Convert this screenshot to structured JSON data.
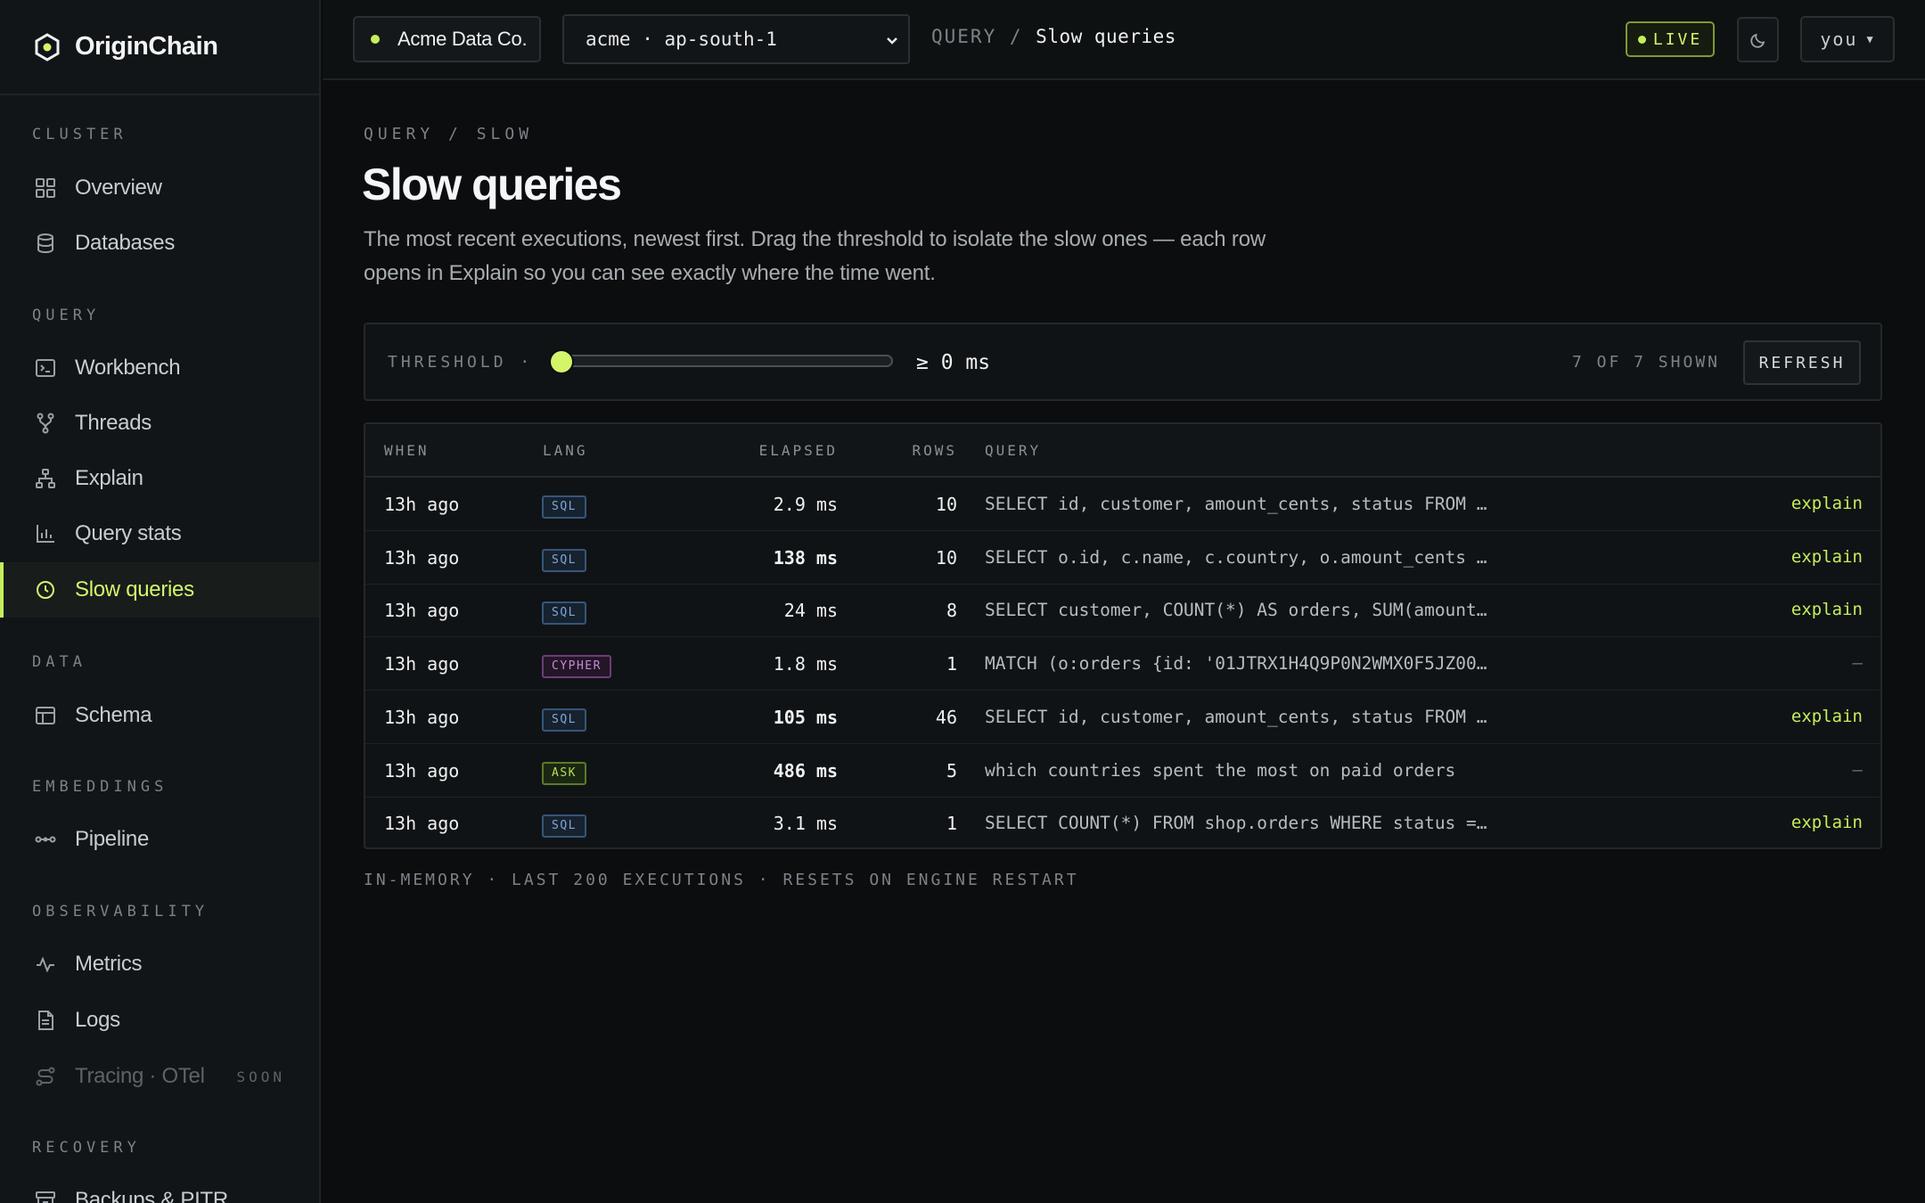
{
  "brand": {
    "name": "OriginChain"
  },
  "sidebar": {
    "sections": [
      {
        "label": "CLUSTER"
      },
      {
        "label": "QUERY"
      },
      {
        "label": "DATA"
      },
      {
        "label": "EMBEDDINGS"
      },
      {
        "label": "OBSERVABILITY"
      },
      {
        "label": "RECOVERY"
      }
    ],
    "items": [
      {
        "label": "Overview",
        "icon": "grid-icon"
      },
      {
        "label": "Databases",
        "icon": "database-icon"
      },
      {
        "label": "Workbench",
        "icon": "terminal-icon"
      },
      {
        "label": "Threads",
        "icon": "branch-icon"
      },
      {
        "label": "Explain",
        "icon": "tree-icon"
      },
      {
        "label": "Query stats",
        "icon": "bar-chart-icon"
      },
      {
        "label": "Slow queries",
        "icon": "clock-icon",
        "active": true
      },
      {
        "label": "Schema",
        "icon": "table-icon"
      },
      {
        "label": "Pipeline",
        "icon": "pipeline-icon"
      },
      {
        "label": "Metrics",
        "icon": "activity-icon"
      },
      {
        "label": "Logs",
        "icon": "file-icon"
      },
      {
        "label": "Tracing · OTel",
        "icon": "route-icon",
        "disabled": true,
        "badge": "SOON"
      },
      {
        "label": "Backups & PITR",
        "icon": "archive-icon"
      }
    ]
  },
  "topbar": {
    "org": "Acme Data Co.",
    "region": "acme · ap-south-1",
    "crumb_section": "QUERY /",
    "crumb_current": "Slow queries",
    "live": "LIVE",
    "user": "you"
  },
  "page": {
    "eyebrow": "QUERY / SLOW",
    "title": "Slow queries",
    "description": "The most recent executions, newest first. Drag the threshold to isolate the slow ones — each row opens in Explain so you can see exactly where the time went."
  },
  "threshold": {
    "label": "THRESHOLD ·",
    "value_text": "≥ 0 ms",
    "slider_fraction": 0,
    "shown": "7 OF 7 SHOWN",
    "refresh": "REFRESH"
  },
  "table": {
    "columns": [
      "WHEN",
      "LANG",
      "ELAPSED",
      "ROWS",
      "QUERY"
    ],
    "rows": [
      {
        "when": "13h ago",
        "lang": "SQL",
        "elapsed": "2.9 ms",
        "bold": false,
        "rows": "10",
        "query": "SELECT id, customer, amount_cents, status FROM …",
        "action": "explain"
      },
      {
        "when": "13h ago",
        "lang": "SQL",
        "elapsed": "138 ms",
        "bold": true,
        "rows": "10",
        "query": "SELECT o.id, c.name, c.country, o.amount_cents …",
        "action": "explain"
      },
      {
        "when": "13h ago",
        "lang": "SQL",
        "elapsed": "24 ms",
        "bold": false,
        "rows": "8",
        "query": "SELECT customer, COUNT(*) AS orders, SUM(amount…",
        "action": "explain"
      },
      {
        "when": "13h ago",
        "lang": "CYPHER",
        "elapsed": "1.8 ms",
        "bold": false,
        "rows": "1",
        "query": "MATCH (o:orders {id: '01JTRX1H4Q9P0N2WMX0F5JZ00…",
        "action": "—"
      },
      {
        "when": "13h ago",
        "lang": "SQL",
        "elapsed": "105 ms",
        "bold": true,
        "rows": "46",
        "query": "SELECT id, customer, amount_cents, status FROM …",
        "action": "explain"
      },
      {
        "when": "13h ago",
        "lang": "ASK",
        "elapsed": "486 ms",
        "bold": true,
        "rows": "5",
        "query": "which countries spent the most on paid orders",
        "action": "—"
      },
      {
        "when": "13h ago",
        "lang": "SQL",
        "elapsed": "3.1 ms",
        "bold": false,
        "rows": "1",
        "query": "SELECT COUNT(*) FROM shop.orders WHERE status =…",
        "action": "explain"
      }
    ]
  },
  "footnote": "IN-MEMORY · LAST 200 EXECUTIONS · RESETS ON ENGINE RESTART",
  "colors": {
    "accent": "#c6ee5c",
    "background": "#0b0d0e",
    "sql": "#7fa6d6",
    "cypher": "#c58ad4",
    "ask": "#b4de5a"
  }
}
